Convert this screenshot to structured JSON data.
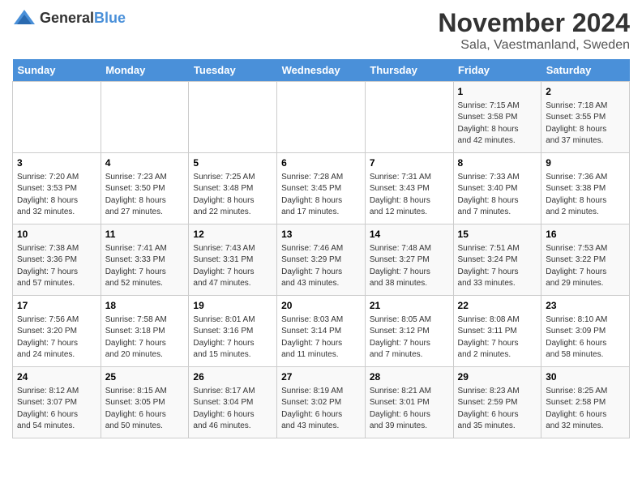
{
  "logo": {
    "general": "General",
    "blue": "Blue"
  },
  "title": "November 2024",
  "subtitle": "Sala, Vaestmanland, Sweden",
  "days_of_week": [
    "Sunday",
    "Monday",
    "Tuesday",
    "Wednesday",
    "Thursday",
    "Friday",
    "Saturday"
  ],
  "weeks": [
    [
      {
        "day": "",
        "info": ""
      },
      {
        "day": "",
        "info": ""
      },
      {
        "day": "",
        "info": ""
      },
      {
        "day": "",
        "info": ""
      },
      {
        "day": "",
        "info": ""
      },
      {
        "day": "1",
        "info": "Sunrise: 7:15 AM\nSunset: 3:58 PM\nDaylight: 8 hours\nand 42 minutes."
      },
      {
        "day": "2",
        "info": "Sunrise: 7:18 AM\nSunset: 3:55 PM\nDaylight: 8 hours\nand 37 minutes."
      }
    ],
    [
      {
        "day": "3",
        "info": "Sunrise: 7:20 AM\nSunset: 3:53 PM\nDaylight: 8 hours\nand 32 minutes."
      },
      {
        "day": "4",
        "info": "Sunrise: 7:23 AM\nSunset: 3:50 PM\nDaylight: 8 hours\nand 27 minutes."
      },
      {
        "day": "5",
        "info": "Sunrise: 7:25 AM\nSunset: 3:48 PM\nDaylight: 8 hours\nand 22 minutes."
      },
      {
        "day": "6",
        "info": "Sunrise: 7:28 AM\nSunset: 3:45 PM\nDaylight: 8 hours\nand 17 minutes."
      },
      {
        "day": "7",
        "info": "Sunrise: 7:31 AM\nSunset: 3:43 PM\nDaylight: 8 hours\nand 12 minutes."
      },
      {
        "day": "8",
        "info": "Sunrise: 7:33 AM\nSunset: 3:40 PM\nDaylight: 8 hours\nand 7 minutes."
      },
      {
        "day": "9",
        "info": "Sunrise: 7:36 AM\nSunset: 3:38 PM\nDaylight: 8 hours\nand 2 minutes."
      }
    ],
    [
      {
        "day": "10",
        "info": "Sunrise: 7:38 AM\nSunset: 3:36 PM\nDaylight: 7 hours\nand 57 minutes."
      },
      {
        "day": "11",
        "info": "Sunrise: 7:41 AM\nSunset: 3:33 PM\nDaylight: 7 hours\nand 52 minutes."
      },
      {
        "day": "12",
        "info": "Sunrise: 7:43 AM\nSunset: 3:31 PM\nDaylight: 7 hours\nand 47 minutes."
      },
      {
        "day": "13",
        "info": "Sunrise: 7:46 AM\nSunset: 3:29 PM\nDaylight: 7 hours\nand 43 minutes."
      },
      {
        "day": "14",
        "info": "Sunrise: 7:48 AM\nSunset: 3:27 PM\nDaylight: 7 hours\nand 38 minutes."
      },
      {
        "day": "15",
        "info": "Sunrise: 7:51 AM\nSunset: 3:24 PM\nDaylight: 7 hours\nand 33 minutes."
      },
      {
        "day": "16",
        "info": "Sunrise: 7:53 AM\nSunset: 3:22 PM\nDaylight: 7 hours\nand 29 minutes."
      }
    ],
    [
      {
        "day": "17",
        "info": "Sunrise: 7:56 AM\nSunset: 3:20 PM\nDaylight: 7 hours\nand 24 minutes."
      },
      {
        "day": "18",
        "info": "Sunrise: 7:58 AM\nSunset: 3:18 PM\nDaylight: 7 hours\nand 20 minutes."
      },
      {
        "day": "19",
        "info": "Sunrise: 8:01 AM\nSunset: 3:16 PM\nDaylight: 7 hours\nand 15 minutes."
      },
      {
        "day": "20",
        "info": "Sunrise: 8:03 AM\nSunset: 3:14 PM\nDaylight: 7 hours\nand 11 minutes."
      },
      {
        "day": "21",
        "info": "Sunrise: 8:05 AM\nSunset: 3:12 PM\nDaylight: 7 hours\nand 7 minutes."
      },
      {
        "day": "22",
        "info": "Sunrise: 8:08 AM\nSunset: 3:11 PM\nDaylight: 7 hours\nand 2 minutes."
      },
      {
        "day": "23",
        "info": "Sunrise: 8:10 AM\nSunset: 3:09 PM\nDaylight: 6 hours\nand 58 minutes."
      }
    ],
    [
      {
        "day": "24",
        "info": "Sunrise: 8:12 AM\nSunset: 3:07 PM\nDaylight: 6 hours\nand 54 minutes."
      },
      {
        "day": "25",
        "info": "Sunrise: 8:15 AM\nSunset: 3:05 PM\nDaylight: 6 hours\nand 50 minutes."
      },
      {
        "day": "26",
        "info": "Sunrise: 8:17 AM\nSunset: 3:04 PM\nDaylight: 6 hours\nand 46 minutes."
      },
      {
        "day": "27",
        "info": "Sunrise: 8:19 AM\nSunset: 3:02 PM\nDaylight: 6 hours\nand 43 minutes."
      },
      {
        "day": "28",
        "info": "Sunrise: 8:21 AM\nSunset: 3:01 PM\nDaylight: 6 hours\nand 39 minutes."
      },
      {
        "day": "29",
        "info": "Sunrise: 8:23 AM\nSunset: 2:59 PM\nDaylight: 6 hours\nand 35 minutes."
      },
      {
        "day": "30",
        "info": "Sunrise: 8:25 AM\nSunset: 2:58 PM\nDaylight: 6 hours\nand 32 minutes."
      }
    ]
  ]
}
